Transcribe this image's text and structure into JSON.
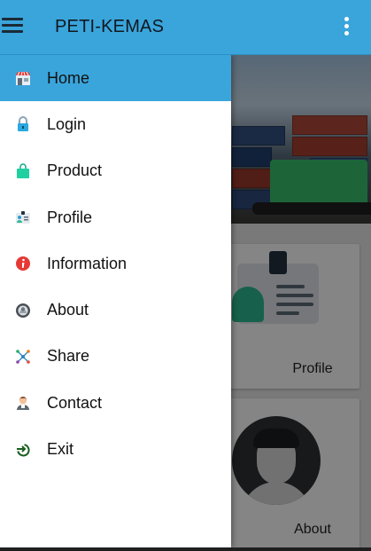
{
  "app_bar": {
    "title": "PETI-KEMAS",
    "menu_icon": "hamburger-menu-icon",
    "overflow_icon": "more-vert-icon",
    "color": "#3aa5db"
  },
  "drawer": {
    "items": [
      {
        "label": "Home",
        "icon": "store-icon",
        "active": true
      },
      {
        "label": "Login",
        "icon": "lock-icon",
        "active": false
      },
      {
        "label": "Product",
        "icon": "shopping-bag-icon",
        "active": false
      },
      {
        "label": "Profile",
        "icon": "id-card-icon",
        "active": false
      },
      {
        "label": "Information",
        "icon": "info-icon",
        "active": false
      },
      {
        "label": "About",
        "icon": "about-icon",
        "active": false
      },
      {
        "label": "Share",
        "icon": "share-icon",
        "active": false
      },
      {
        "label": "Contact",
        "icon": "contact-person-icon",
        "active": false
      },
      {
        "label": "Exit",
        "icon": "exit-icon",
        "active": false
      }
    ]
  },
  "content": {
    "cards": [
      {
        "label": "Profile",
        "icon": "id-card-icon"
      },
      {
        "label": "About",
        "icon": "user-avatar-icon"
      }
    ]
  }
}
